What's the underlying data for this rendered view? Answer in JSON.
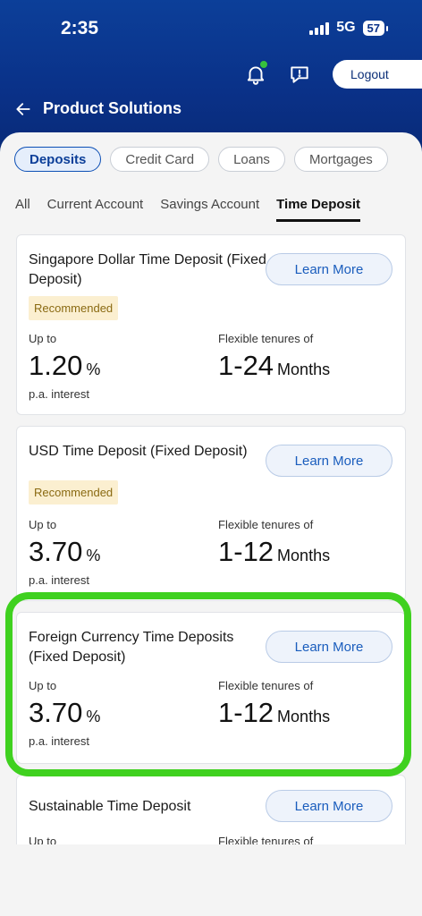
{
  "status": {
    "time": "2:35",
    "network": "5G",
    "battery": "57"
  },
  "header": {
    "logout_label": "Logout",
    "title": "Product Solutions"
  },
  "chips": [
    {
      "label": "Deposits",
      "active": true
    },
    {
      "label": "Credit Card",
      "active": false
    },
    {
      "label": "Loans",
      "active": false
    },
    {
      "label": "Mortgages",
      "active": false
    }
  ],
  "tabs": [
    {
      "label": "All",
      "active": false
    },
    {
      "label": "Current Account",
      "active": false
    },
    {
      "label": "Savings Account",
      "active": false
    },
    {
      "label": "Time Deposit",
      "active": true
    }
  ],
  "products": [
    {
      "title": "Singapore Dollar Time Deposit (Fixed Deposit)",
      "button": "Learn More",
      "badge": "Recommended",
      "rate_prefix": "Up to",
      "rate": "1.20",
      "rate_unit": "%",
      "rate_suffix": "p.a. interest",
      "tenure_prefix": "Flexible tenures of",
      "tenure": "1-24",
      "tenure_unit": "Months"
    },
    {
      "title": "USD Time Deposit (Fixed Deposit)",
      "button": "Learn More",
      "badge": "Recommended",
      "rate_prefix": "Up to",
      "rate": "3.70",
      "rate_unit": "%",
      "rate_suffix": "p.a. interest",
      "tenure_prefix": "Flexible tenures of",
      "tenure": "1-12",
      "tenure_unit": "Months"
    },
    {
      "title": "Foreign Currency Time Deposits (Fixed Deposit)",
      "button": "Learn More",
      "rate_prefix": "Up to",
      "rate": "3.70",
      "rate_unit": "%",
      "rate_suffix": "p.a. interest",
      "tenure_prefix": "Flexible tenures of",
      "tenure": "1-12",
      "tenure_unit": "Months"
    },
    {
      "title": "Sustainable Time Deposit",
      "button": "Learn More",
      "rate_prefix": "Up to",
      "tenure_prefix": "Flexible tenures of"
    }
  ],
  "icons": {
    "notification": "bell-icon",
    "messages": "chat-icon",
    "back": "arrow-left-icon"
  },
  "colors": {
    "brand": "#0a3188",
    "highlight": "#3fd11f",
    "accent": "#1a5dbd"
  }
}
